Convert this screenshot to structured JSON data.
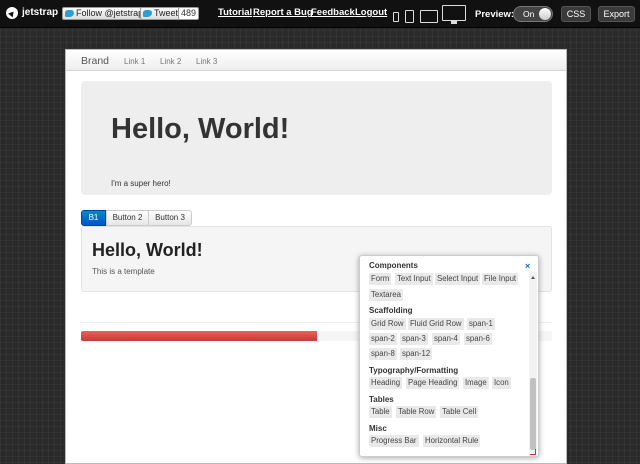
{
  "topbar": {
    "logo": "jetstrap",
    "follow": "Follow @jetstrap",
    "tweet": "Tweet",
    "tweet_count": "489",
    "links": [
      "Tutorial",
      "Report a Bug",
      "Feedback",
      "Logout"
    ],
    "preview_label": "Preview:",
    "toggle": "On",
    "css_button": "CSS",
    "export_button": "Export"
  },
  "preview": {
    "navbar": {
      "brand": "Brand",
      "links": [
        "Link 1",
        "Link 2",
        "Link 3"
      ]
    },
    "hero": {
      "title": "Hello, World!",
      "subtitle": "I'm a super hero!"
    },
    "button_group": [
      "B1",
      "Button 2",
      "Button 3"
    ],
    "well": {
      "title": "Hello, World!",
      "subtitle": "This is a template"
    },
    "progress": {
      "value": 0.5,
      "color": "#d9534f"
    }
  },
  "components": {
    "close": "×",
    "sections": [
      {
        "title": "Components",
        "items": [
          "Form",
          "Text Input",
          "Select Input",
          "File Input",
          "Textarea"
        ]
      },
      {
        "title": "Scaffolding",
        "items": [
          "Grid Row",
          "Fluid Grid Row",
          "span-1",
          "span-2",
          "span-3",
          "span-4",
          "span-6",
          "span-8",
          "span-12"
        ]
      },
      {
        "title": "Typography/Formatting",
        "items": [
          "Heading",
          "Page Heading",
          "Image",
          "Icon"
        ]
      },
      {
        "title": "Tables",
        "items": [
          "Table",
          "Table Row",
          "Table Cell"
        ]
      },
      {
        "title": "Misc",
        "items": [
          "Progress Bar",
          "Horizontal Rule"
        ]
      }
    ]
  }
}
